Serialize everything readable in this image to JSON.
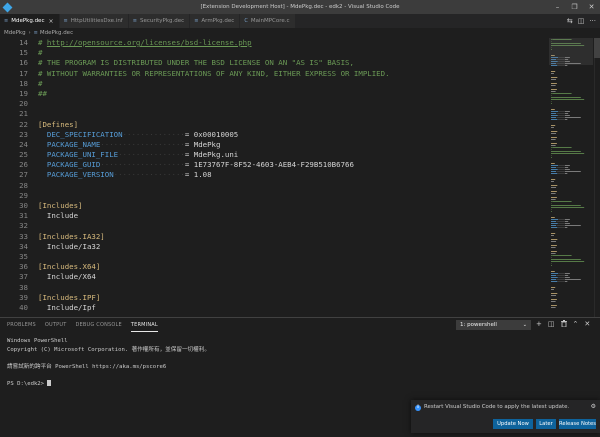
{
  "window": {
    "title": "[Extension Development Host] - MdePkg.dec - edk2 - Visual Studio Code",
    "controls": [
      "minimize-icon",
      "restore-icon",
      "close-icon"
    ],
    "controls_glyphs": [
      "–",
      "❐",
      "✕"
    ]
  },
  "menus": [],
  "tabs": [
    {
      "label": "MdePkg.dec",
      "active": true,
      "close": "×"
    },
    {
      "label": "HttpUtilitiesDxe.inf",
      "active": false
    },
    {
      "label": "SecurityPkg.dec",
      "active": false
    },
    {
      "label": "ArmPkg.dec",
      "active": false
    },
    {
      "label": "MainMPCore.c",
      "active": false,
      "icon": "C"
    }
  ],
  "tab_actions": [
    "compare-icon",
    "split-editor-icon",
    "more-icon"
  ],
  "tab_actions_glyphs": [
    "⇆",
    "◫",
    "···"
  ],
  "breadcrumb": {
    "folder": "MdePkg",
    "separator": "›",
    "file": "MdePkg.dec"
  },
  "editor": {
    "lines": [
      {
        "n": "14",
        "parts": [
          {
            "t": "# ",
            "c": "comment"
          },
          {
            "t": "http://opensource.org/licenses/bsd-license.php",
            "c": "link"
          }
        ]
      },
      {
        "n": "15",
        "parts": [
          {
            "t": "#",
            "c": "comment"
          }
        ]
      },
      {
        "n": "16",
        "parts": [
          {
            "t": "# THE PROGRAM IS DISTRIBUTED UNDER THE BSD LICENSE ON AN \"AS IS\" BASIS,",
            "c": "comment"
          }
        ]
      },
      {
        "n": "17",
        "parts": [
          {
            "t": "# WITHOUT WARRANTIES OR REPRESENTATIONS OF ANY KIND, EITHER EXPRESS OR IMPLIED.",
            "c": "comment"
          }
        ]
      },
      {
        "n": "18",
        "parts": [
          {
            "t": "#",
            "c": "comment"
          }
        ]
      },
      {
        "n": "19",
        "parts": [
          {
            "t": "##",
            "c": "comment"
          }
        ]
      },
      {
        "n": "20",
        "parts": []
      },
      {
        "n": "21",
        "parts": []
      },
      {
        "n": "22",
        "parts": [
          {
            "t": "[Defines]",
            "c": "section"
          }
        ]
      },
      {
        "n": "23",
        "parts": [
          {
            "t": "  DEC_SPECIFICATION",
            "c": "key"
          },
          {
            "t": "··············",
            "c": "dots"
          },
          {
            "t": "= 0x00010005",
            "c": "val"
          }
        ]
      },
      {
        "n": "24",
        "parts": [
          {
            "t": "  PACKAGE_NAME",
            "c": "key"
          },
          {
            "t": "···················",
            "c": "dots"
          },
          {
            "t": "= MdePkg",
            "c": "val"
          }
        ]
      },
      {
        "n": "25",
        "parts": [
          {
            "t": "  PACKAGE_UNI_FILE",
            "c": "key"
          },
          {
            "t": "···············",
            "c": "dots"
          },
          {
            "t": "= MdePkg.uni",
            "c": "val"
          }
        ]
      },
      {
        "n": "26",
        "parts": [
          {
            "t": "  PACKAGE_GUID",
            "c": "key"
          },
          {
            "t": "···················",
            "c": "dots"
          },
          {
            "t": "= 1E73767F-8F52-4603-AEB4-F29B510B6766",
            "c": "val"
          }
        ]
      },
      {
        "n": "27",
        "parts": [
          {
            "t": "  PACKAGE_VERSION",
            "c": "key"
          },
          {
            "t": "················",
            "c": "dots"
          },
          {
            "t": "= 1.08",
            "c": "val"
          }
        ]
      },
      {
        "n": "28",
        "parts": []
      },
      {
        "n": "29",
        "parts": []
      },
      {
        "n": "30",
        "parts": [
          {
            "t": "[Includes]",
            "c": "section"
          }
        ]
      },
      {
        "n": "31",
        "parts": [
          {
            "t": "  Include",
            "c": "text"
          }
        ]
      },
      {
        "n": "32",
        "parts": []
      },
      {
        "n": "33",
        "parts": [
          {
            "t": "[Includes.IA32]",
            "c": "section"
          }
        ]
      },
      {
        "n": "34",
        "parts": [
          {
            "t": "  Include/Ia32",
            "c": "text"
          }
        ]
      },
      {
        "n": "35",
        "parts": []
      },
      {
        "n": "36",
        "parts": [
          {
            "t": "[Includes.X64]",
            "c": "section"
          }
        ]
      },
      {
        "n": "37",
        "parts": [
          {
            "t": "  Include/X64",
            "c": "text"
          }
        ]
      },
      {
        "n": "38",
        "parts": []
      },
      {
        "n": "39",
        "parts": [
          {
            "t": "[Includes.IPF]",
            "c": "section"
          }
        ]
      },
      {
        "n": "40",
        "parts": [
          {
            "t": "  Include/Ipf",
            "c": "text"
          }
        ]
      }
    ]
  },
  "colors": {
    "comment": "#6a9955",
    "section": "#d7ba7d",
    "key": "#569cd6",
    "accent": "#0e639c"
  },
  "panel": {
    "tabs": [
      {
        "label": "PROBLEMS",
        "active": false
      },
      {
        "label": "OUTPUT",
        "active": false
      },
      {
        "label": "DEBUG CONSOLE",
        "active": false
      },
      {
        "label": "TERMINAL",
        "active": true
      }
    ],
    "terminal_select": "1: powershell",
    "actions": [
      "add-terminal-icon",
      "split-terminal-icon",
      "kill-terminal-icon",
      "maximize-panel-icon",
      "close-panel-icon"
    ],
    "actions_glyphs": [
      "+",
      "◫",
      "🗑",
      "⌃",
      "✕"
    ],
    "terminal_lines": [
      "Windows PowerShell",
      "Copyright (C) Microsoft Corporation. 著作權所有，並保留一切權利。",
      "",
      "請嘗試新的跨平台 PowerShell https://aka.ms/pscore6",
      "",
      "PS D:\\edk2> "
    ]
  },
  "notification": {
    "icon": "info-icon",
    "icon_glyph": "i",
    "message": "Restart Visual Studio Code to apply the latest update.",
    "settings_glyph": "⚙",
    "buttons": [
      {
        "label": "Update Now"
      },
      {
        "label": "Later"
      },
      {
        "label": "Release Notes"
      }
    ]
  }
}
